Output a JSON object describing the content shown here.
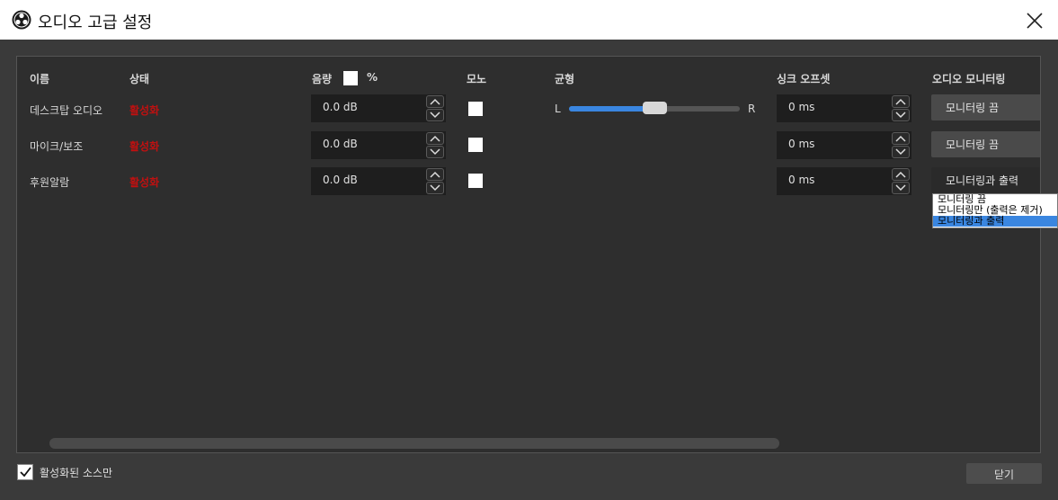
{
  "window": {
    "title": "오디오 고급 설정"
  },
  "columns": {
    "name": "이름",
    "status": "상태",
    "volume": "음량",
    "volume_unit": "%",
    "mono": "모노",
    "balance": "균형",
    "sync_offset": "싱크 오프셋",
    "monitoring": "오디오 모니터링"
  },
  "rows": [
    {
      "name": "데스크탑 오디오",
      "status": "활성화",
      "volume": "0.0 dB",
      "sync": "0 ms",
      "monitoring": "모니터링 끔"
    },
    {
      "name": "마이크/보조",
      "status": "활성화",
      "volume": "0.0 dB",
      "sync": "0 ms",
      "monitoring": "모니터링 끔"
    },
    {
      "name": "후원알람",
      "status": "활성화",
      "volume": "0.0 dB",
      "sync": "0 ms",
      "monitoring": "모니터링과 출력"
    }
  ],
  "balance": {
    "left_label": "L",
    "right_label": "R",
    "value": 0.5
  },
  "dropdown": {
    "options": [
      "모니터링 끔",
      "모니터링만 (출력은 제거)",
      "모니터링과 출력"
    ],
    "selected_index": 2
  },
  "footer": {
    "only_active_label": "활성화된 소스만",
    "only_active_checked": true,
    "close_label": "닫기"
  },
  "colors": {
    "status_active": "#c01010",
    "accent": "#3a86e0"
  }
}
